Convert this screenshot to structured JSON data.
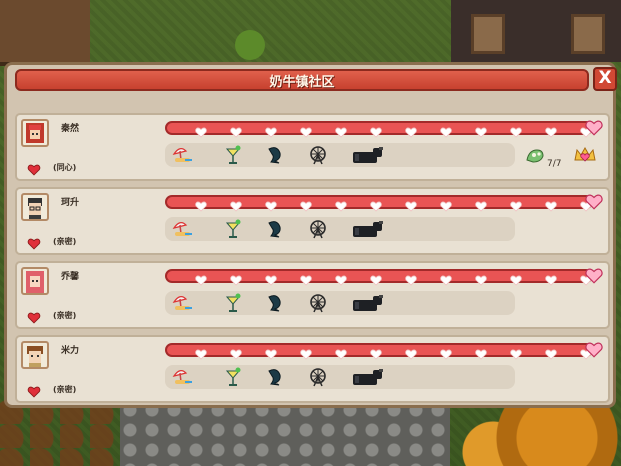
{
  "window": {
    "title": "奶牛镇社区",
    "close_label": "X"
  },
  "residents": [
    {
      "name": "秦然",
      "status": "(同心)",
      "avatar": "red-hair-girl-avatar",
      "hearts_filled": 1.0,
      "show_gift_bonus": true,
      "gift_bonus_count": "7/7"
    },
    {
      "name": "珂升",
      "status": "(亲密)",
      "avatar": "glasses-boy-avatar",
      "hearts_filled": 1.0,
      "show_gift_bonus": false
    },
    {
      "name": "乔馨",
      "status": "(亲密)",
      "avatar": "pink-hair-girl-avatar",
      "hearts_filled": 1.0,
      "show_gift_bonus": false
    },
    {
      "name": "米力",
      "status": "(亲密)",
      "avatar": "brown-hair-boy-avatar",
      "hearts_filled": 1.0,
      "show_gift_bonus": false
    }
  ],
  "gift_icons": [
    "sunbath-icon",
    "cocktail-icon",
    "fish-icon",
    "ferris-wheel-icon",
    "cow-statue-icon"
  ],
  "colors": {
    "title_red": "#d8523e",
    "heart_bar": "#e95454",
    "panel": "#d2c4b0"
  }
}
